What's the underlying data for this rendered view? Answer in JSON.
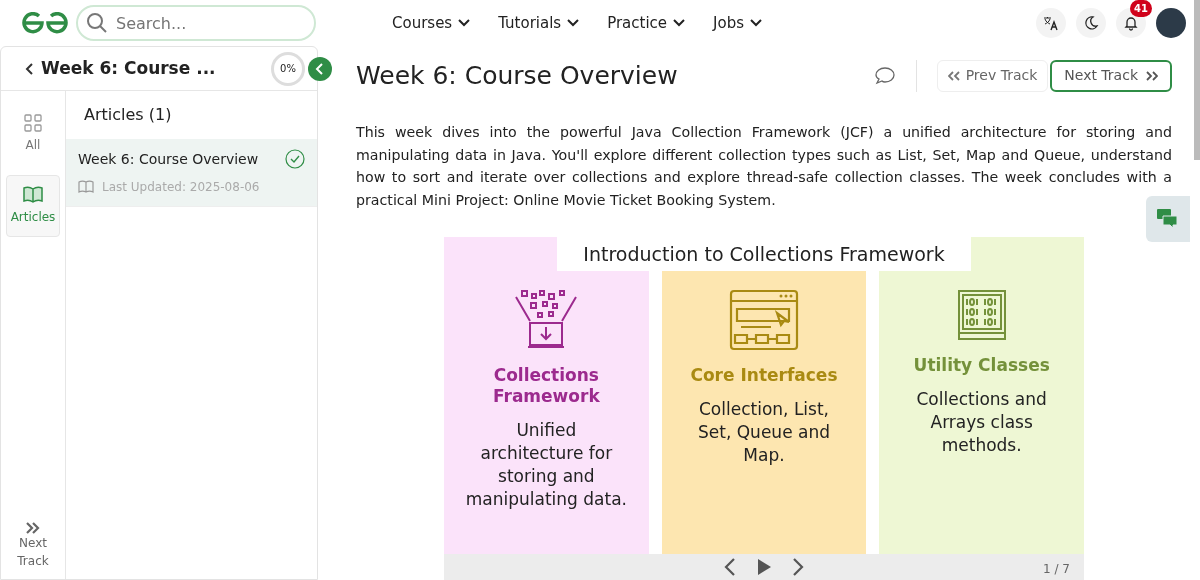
{
  "header": {
    "search": {
      "placeholder": "Search..."
    },
    "nav": [
      {
        "label": "Courses"
      },
      {
        "label": "Tutorials"
      },
      {
        "label": "Practice"
      },
      {
        "label": "Jobs"
      }
    ],
    "notifications": {
      "count": "41"
    }
  },
  "sidebar": {
    "title": "Week 6: Course ...",
    "progress": {
      "label": "0%"
    },
    "rail": [
      {
        "kind": "all",
        "label": "All",
        "selected": false
      },
      {
        "kind": "articles",
        "label": "Articles",
        "selected": true
      }
    ],
    "next_track": "Next Track",
    "section_title": "Articles (1)",
    "items": [
      {
        "title": "Week 6: Course Overview",
        "meta": "Last Updated: 2025-08-06",
        "completed": true,
        "selected": true
      }
    ]
  },
  "content": {
    "title": "Week 6: Course Overview",
    "prev_button": "Prev Track",
    "next_button": "Next Track",
    "description": "This week dives into the powerful Java Collection Framework (JCF) a unified architecture for storing and manipulating data in Java. You'll explore different collection types such as List, Set, Map and Queue, understand how to sort and iterate over collections and explore thread-safe collection classes. The week concludes with a practical Mini Project: Online Movie Ticket Booking System.",
    "slide": {
      "title": "Introduction to Collections Framework",
      "counter": "1 / 7",
      "columns": [
        {
          "kind": "funnel",
          "heading": "Collections Framework",
          "text": "Unified architecture for storing and manipulating data.",
          "color": "#9c2a8e"
        },
        {
          "kind": "window",
          "heading": "Core Interfaces",
          "text": "Collection, List, Set, Queue and Map.",
          "color": "#a98a12"
        },
        {
          "kind": "binary",
          "heading": "Utility Classes",
          "text": "Collections and Arrays class methods.",
          "color": "#74913a"
        }
      ]
    }
  }
}
